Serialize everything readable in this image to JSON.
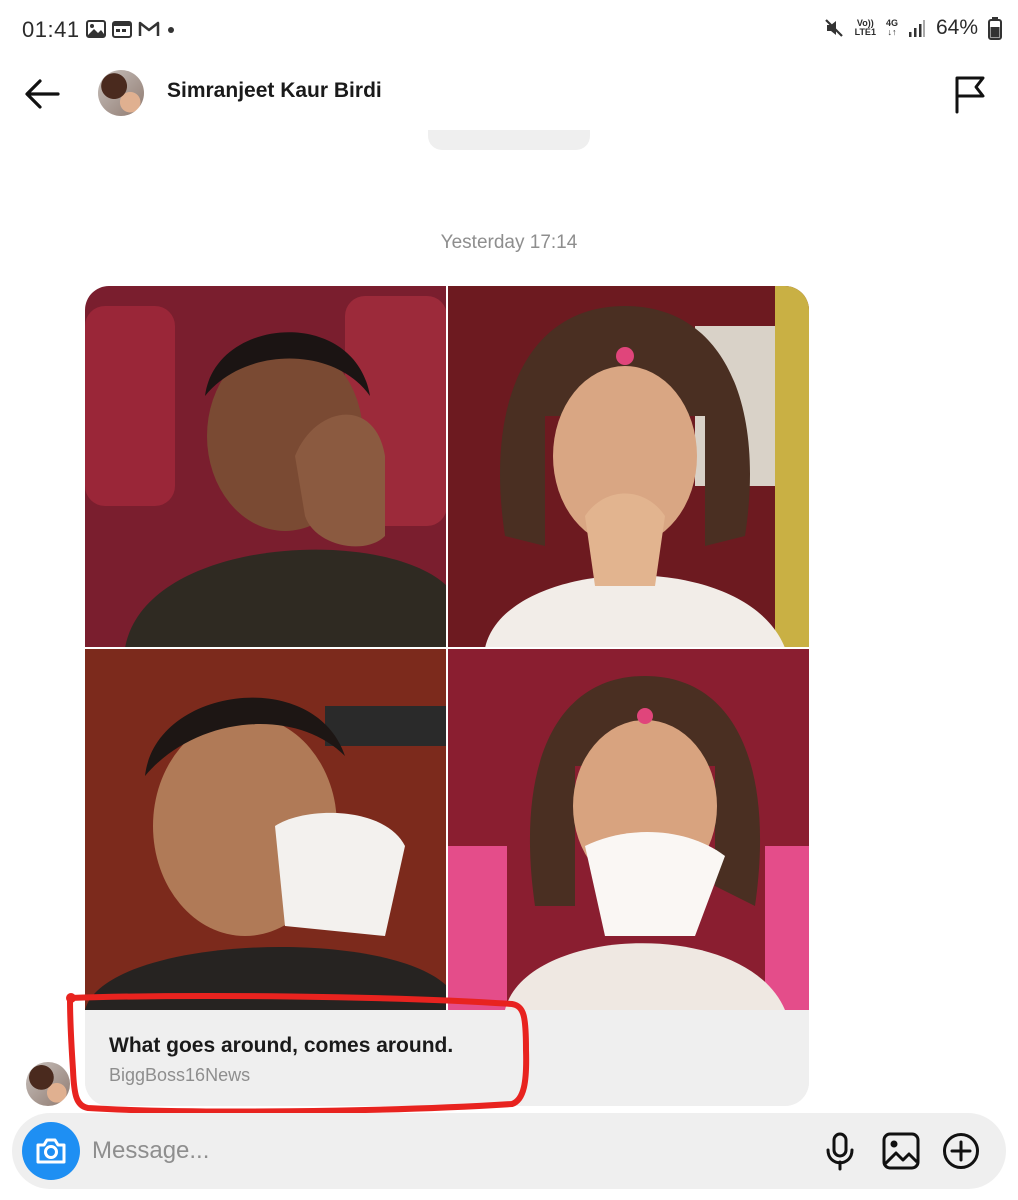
{
  "status_bar": {
    "time": "01:41",
    "network_top": "Vo))",
    "network_bottom": "LTE1",
    "network_type": "4G",
    "battery": "64%"
  },
  "header": {
    "contact_name": "Simranjeet Kaur Birdi"
  },
  "chat": {
    "timestamp": "Yesterday 17:14",
    "shared_post": {
      "caption": "What goes around, comes around.",
      "source": "BiggBoss16News"
    }
  },
  "composer": {
    "placeholder": "Message..."
  },
  "colors": {
    "accent": "#1e8ff3",
    "annotation": "#e8231f",
    "bubble": "#efefef",
    "muted_text": "#8e8e8e"
  }
}
